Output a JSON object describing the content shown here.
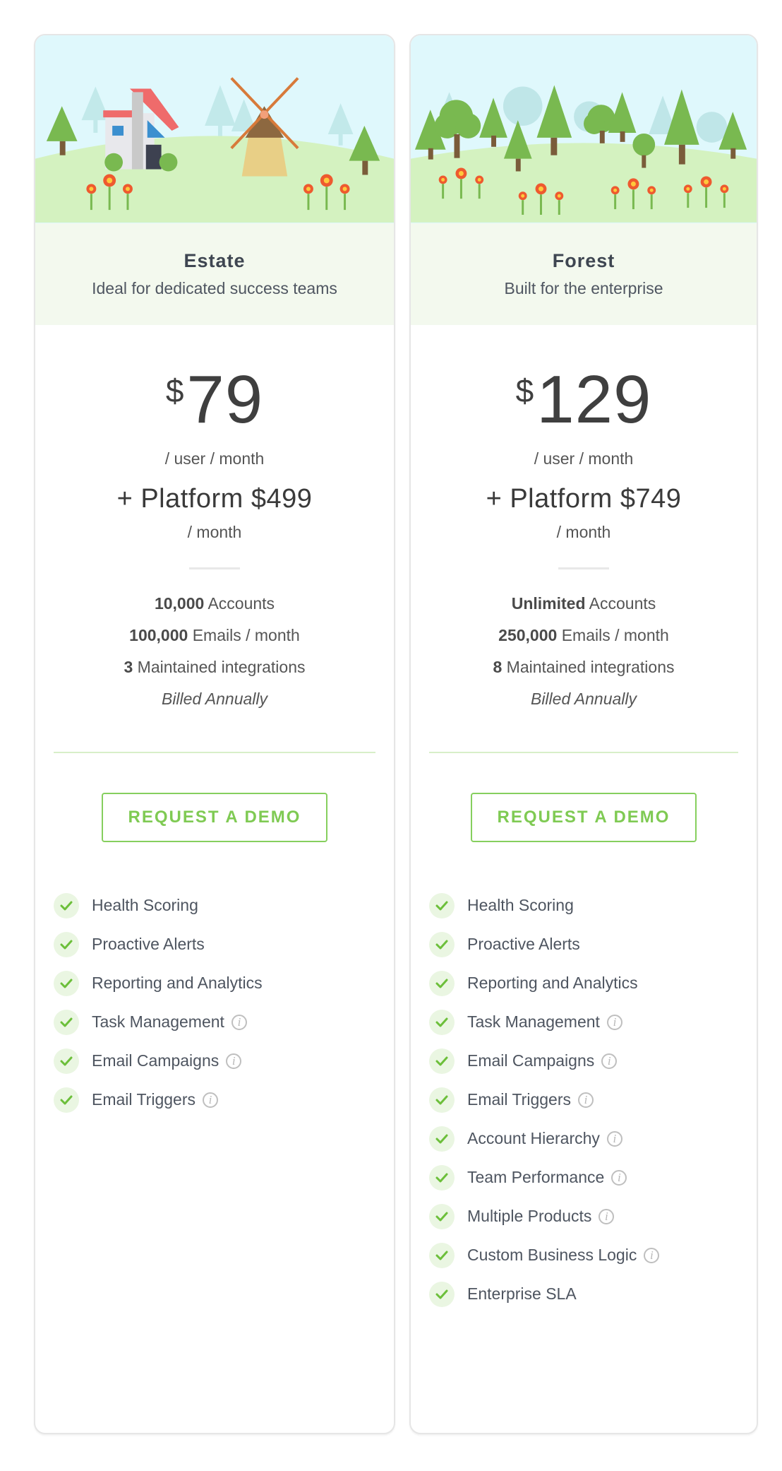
{
  "plans": [
    {
      "name": "Estate",
      "tagline": "Ideal for dedicated success teams",
      "illustration": "house-and-windmill-icon",
      "currency": "$",
      "price": "79",
      "price_period": "/ user / month",
      "platform": "+ Platform $499",
      "platform_period": "/ month",
      "quotas": [
        {
          "value": "10,000",
          "label": "Accounts"
        },
        {
          "value": "100,000",
          "label": "Emails / month"
        },
        {
          "value": "3",
          "label": "Maintained integrations"
        }
      ],
      "billing": "Billed Annually",
      "cta": "REQUEST A DEMO",
      "features": [
        {
          "label": "Health Scoring",
          "info": false
        },
        {
          "label": "Proactive Alerts",
          "info": false
        },
        {
          "label": "Reporting and Analytics",
          "info": false
        },
        {
          "label": "Task Management",
          "info": true
        },
        {
          "label": "Email Campaigns",
          "info": true
        },
        {
          "label": "Email Triggers",
          "info": true
        }
      ]
    },
    {
      "name": "Forest",
      "tagline": "Built for the enterprise",
      "illustration": "forest-icon",
      "currency": "$",
      "price": "129",
      "price_period": "/ user / month",
      "platform": "+ Platform $749",
      "platform_period": "/ month",
      "quotas": [
        {
          "value": "Unlimited",
          "label": "Accounts"
        },
        {
          "value": "250,000",
          "label": "Emails / month"
        },
        {
          "value": "8",
          "label": "Maintained integrations"
        }
      ],
      "billing": "Billed Annually",
      "cta": "REQUEST A DEMO",
      "features": [
        {
          "label": "Health Scoring",
          "info": false
        },
        {
          "label": "Proactive Alerts",
          "info": false
        },
        {
          "label": "Reporting and Analytics",
          "info": false
        },
        {
          "label": "Task Management",
          "info": true
        },
        {
          "label": "Email Campaigns",
          "info": true
        },
        {
          "label": "Email Triggers",
          "info": true
        },
        {
          "label": "Account Hierarchy",
          "info": true
        },
        {
          "label": "Team Performance",
          "info": true
        },
        {
          "label": "Multiple Products",
          "info": true
        },
        {
          "label": "Custom Business Logic",
          "info": true
        },
        {
          "label": "Enterprise SLA",
          "info": false
        }
      ]
    }
  ],
  "info_glyph": "i",
  "colors": {
    "accent": "#7fca53",
    "check": "#6cbf3a",
    "sky": "#dff8fc",
    "hill": "#d4f2c0",
    "header_bg": "#f3f9ee"
  }
}
